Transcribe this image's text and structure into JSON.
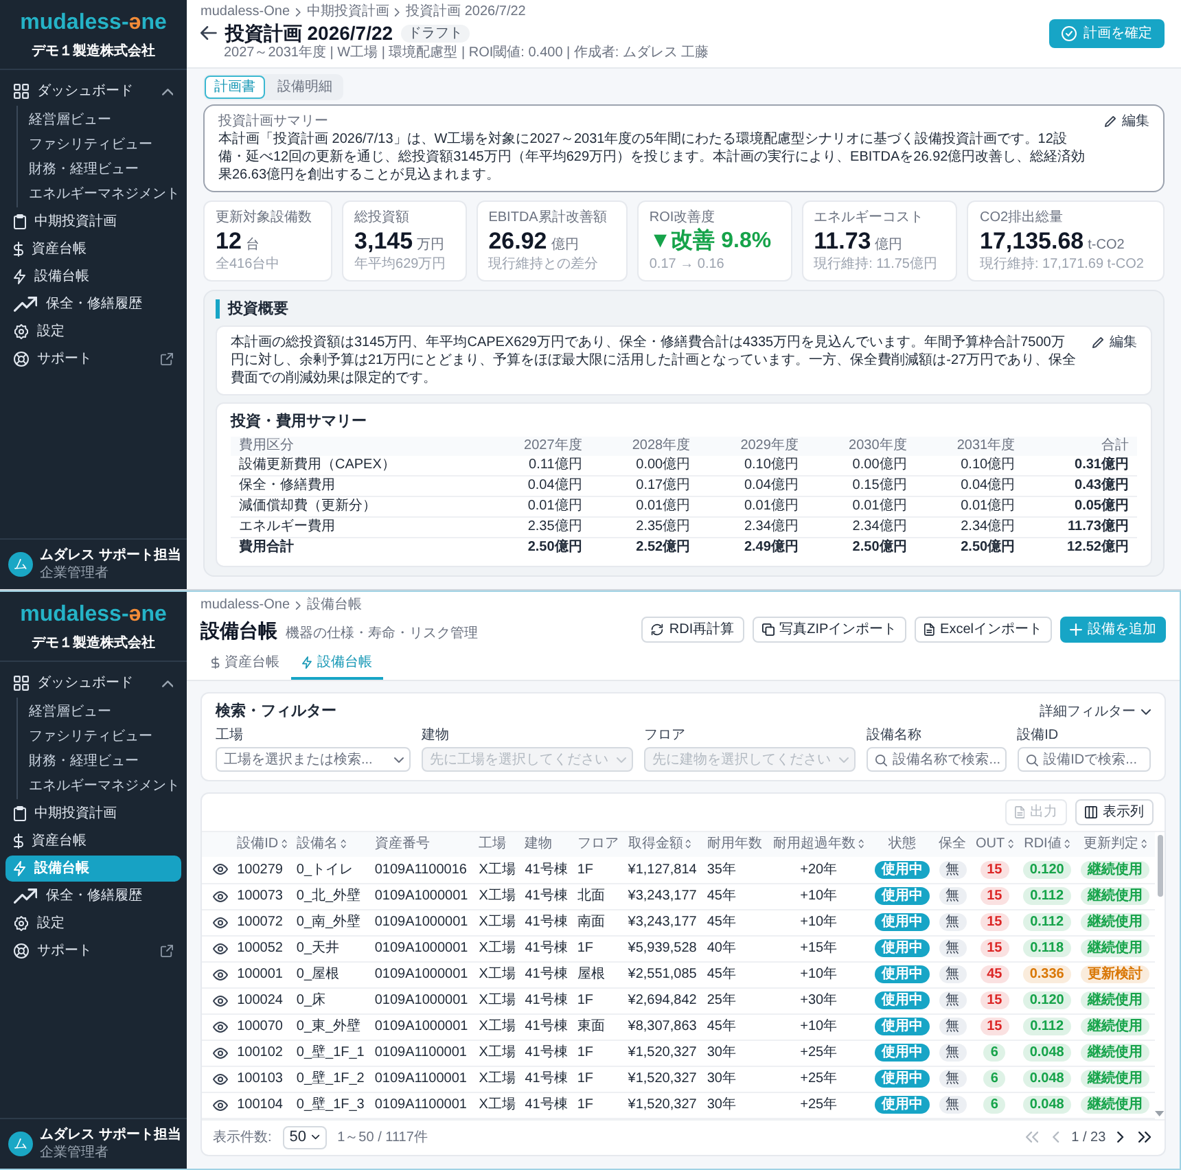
{
  "plan_screen": {
    "sidebar": {
      "logo": {
        "text": "mudaless-",
        "accent": "ə",
        "tail": "ne"
      },
      "company": "デモ１製造株式会社",
      "items": [
        {
          "label": "ダッシュボード",
          "selected": false,
          "expanded": true,
          "children": [
            {
              "label": "経営層ビュー",
              "selected": false
            },
            {
              "label": "ファシリティビュー",
              "selected": false
            },
            {
              "label": "財務・経理ビュー",
              "selected": false
            },
            {
              "label": "エネルギーマネジメント",
              "selected": false
            }
          ]
        },
        {
          "label": "中期投資計画",
          "selected": false
        },
        {
          "label": "資産台帳",
          "selected": false
        },
        {
          "label": "設備台帳",
          "selected": false
        },
        {
          "label": "保全・修繕履歴",
          "selected": false
        },
        {
          "label": "設定",
          "selected": false
        },
        {
          "label": "サポート",
          "selected": false,
          "external": true
        }
      ],
      "user": {
        "avatar": "ム",
        "name": "ムダレス サポート担当",
        "role": "企業管理者"
      }
    },
    "breadcrumb": [
      "mudaless-One",
      "中期投資計画",
      "投資計画 2026/7/22"
    ],
    "title": "投資計画 2026/7/22",
    "badge": "ドラフト",
    "subtitle": "2027～2031年度 | W工場 | 環境配慮型 | ROI閾値: 0.400 | 作成者: ムダレス 工藤",
    "confirm_button": "計画を確定",
    "tabs": [
      {
        "label": "計画書",
        "selected": true
      },
      {
        "label": "設備明細",
        "selected": false
      }
    ],
    "summary": {
      "label": "投資計画サマリー",
      "text": "本計画「投資計画 2026/7/13」は、W工場を対象に2027～2031年度の5年間にわたる環境配慮型シナリオに基づく設備投資計画です。12設備・延べ12回の更新を通じ、総投資額3145万円（年平均629万円）を投じます。本計画の実行により、EBITDAを26.92億円改善し、総経済効果26.63億円を創出することが見込まれます。",
      "edit_button": "編集"
    },
    "kpis": [
      {
        "kind": "metric",
        "label": "更新対象設備数",
        "value": "12",
        "unit": "台",
        "note": "全416台中"
      },
      {
        "kind": "metric",
        "label": "総投資額",
        "value": "3,145",
        "unit": "万円",
        "note": "年平均629万円"
      },
      {
        "kind": "metric",
        "label": "EBITDA累計改善額",
        "value": "26.92",
        "unit": "億円",
        "note": "現行維持との差分"
      },
      {
        "kind": "delta",
        "label": "ROI改善度",
        "value": "▼改善 9.8%",
        "note": "0.17 → 0.16"
      },
      {
        "kind": "metric",
        "label": "エネルギーコスト",
        "value": "11.73",
        "unit": "億円",
        "note": "現行維持: 11.75億円"
      },
      {
        "kind": "metric",
        "label": "CO2排出総量",
        "value": "17,135.68",
        "unit": "t-CO2",
        "note": "現行維持: 17,171.69 t-CO2"
      }
    ],
    "overview": {
      "title": "投資概要",
      "text": "本計画の総投資額は3145万円、年平均CAPEX629万円であり、保全・修繕費合計は4335万円を見込んでいます。年間予算枠合計7500万円に対し、余剰予算は21万円にとどまり、予算をほぼ最大限に活用した計画となっています。一方、保全費削減額は-27万円であり、保全費面での削減効果は限定的です。",
      "edit_button": "編集",
      "cost_table": {
        "title": "投資・費用サマリー",
        "columns": [
          "費用区分",
          "2027年度",
          "2028年度",
          "2029年度",
          "2030年度",
          "2031年度",
          "合計"
        ],
        "rows": [
          {
            "cells": [
              "設備更新費用（CAPEX）",
              "0.11億円",
              "0.00億円",
              "0.10億円",
              "0.00億円",
              "0.10億円",
              "0.31億円"
            ],
            "total": false
          },
          {
            "cells": [
              "保全・修繕費用",
              "0.04億円",
              "0.17億円",
              "0.04億円",
              "0.15億円",
              "0.04億円",
              "0.43億円"
            ],
            "total": false
          },
          {
            "cells": [
              "減価償却費（更新分）",
              "0.01億円",
              "0.01億円",
              "0.01億円",
              "0.01億円",
              "0.01億円",
              "0.05億円"
            ],
            "total": false
          },
          {
            "cells": [
              "エネルギー費用",
              "2.35億円",
              "2.35億円",
              "2.34億円",
              "2.34億円",
              "2.34億円",
              "11.73億円"
            ],
            "total": false
          },
          {
            "cells": [
              "費用合計",
              "2.50億円",
              "2.52億円",
              "2.49億円",
              "2.50億円",
              "2.50億円",
              "12.52億円"
            ],
            "total": true
          }
        ]
      }
    }
  },
  "ledger_screen": {
    "sidebar": {
      "logo": {
        "text": "mudaless-",
        "accent": "ə",
        "tail": "ne"
      },
      "company": "デモ１製造株式会社",
      "items": [
        {
          "label": "ダッシュボード",
          "selected": false,
          "expanded": true,
          "children": [
            {
              "label": "経営層ビュー",
              "selected": false
            },
            {
              "label": "ファシリティビュー",
              "selected": false
            },
            {
              "label": "財務・経理ビュー",
              "selected": false
            },
            {
              "label": "エネルギーマネジメント",
              "selected": false
            }
          ]
        },
        {
          "label": "中期投資計画",
          "selected": false
        },
        {
          "label": "資産台帳",
          "selected": false
        },
        {
          "label": "設備台帳",
          "selected": true
        },
        {
          "label": "保全・修繕履歴",
          "selected": false
        },
        {
          "label": "設定",
          "selected": false
        },
        {
          "label": "サポート",
          "selected": false,
          "external": true
        }
      ],
      "user": {
        "avatar": "ム",
        "name": "ムダレス サポート担当",
        "role": "企業管理者"
      }
    },
    "breadcrumb": [
      "mudaless-One",
      "設備台帳"
    ],
    "title": "設備台帳",
    "subtitle": "機器の仕様・寿命・リスク管理",
    "actions": [
      {
        "label": "RDI再計算",
        "primary": false
      },
      {
        "label": "写真ZIPインポート",
        "primary": false
      },
      {
        "label": "Excelインポート",
        "primary": false
      },
      {
        "label": "設備を追加",
        "primary": true
      }
    ],
    "tabs": [
      {
        "label": "資産台帳",
        "selected": false
      },
      {
        "label": "設備台帳",
        "selected": true
      }
    ],
    "filter": {
      "title": "検索・フィルター",
      "toggle": "詳細フィルター",
      "fields": [
        {
          "label": "工場",
          "kind": "select",
          "placeholder": "工場を選択または検索...",
          "disabled": false
        },
        {
          "label": "建物",
          "kind": "select",
          "placeholder": "先に工場を選択してください",
          "disabled": true
        },
        {
          "label": "フロア",
          "kind": "select",
          "placeholder": "先に建物を選択してください",
          "disabled": true
        },
        {
          "label": "設備名称",
          "kind": "search",
          "placeholder": "設備名称で検索...",
          "disabled": false
        },
        {
          "label": "設備ID",
          "kind": "search",
          "placeholder": "設備IDで検索...",
          "disabled": false
        }
      ]
    },
    "table": {
      "toolbar": [
        {
          "label": "出力",
          "disabled": true
        },
        {
          "label": "表示列",
          "disabled": false
        }
      ],
      "columns": [
        {
          "label": "設備ID",
          "sortable": true
        },
        {
          "label": "設備名",
          "sortable": true
        },
        {
          "label": "資産番号",
          "sortable": false
        },
        {
          "label": "工場",
          "sortable": false
        },
        {
          "label": "建物",
          "sortable": false
        },
        {
          "label": "フロア",
          "sortable": false
        },
        {
          "label": "取得金額",
          "sortable": true
        },
        {
          "label": "耐用年数",
          "sortable": false
        },
        {
          "label": "耐用超過年数",
          "sortable": true
        },
        {
          "label": "状態",
          "sortable": false
        },
        {
          "label": "保全",
          "sortable": false
        },
        {
          "label": "OUT",
          "sortable": true
        },
        {
          "label": "RDI値",
          "sortable": true
        },
        {
          "label": "更新判定",
          "sortable": true
        }
      ],
      "rows": [
        {
          "id": "100279",
          "name": "0_トイレ",
          "asset_no": "0109A1100016",
          "plant": "X工場",
          "building": "41号棟",
          "floor": "1F",
          "acquisition_cost": "¥1,127,814",
          "useful_life": "35年",
          "over_life": "+20年",
          "status": "使用中",
          "maintenance": "無",
          "out": {
            "value": "15",
            "color": "#dc2626"
          },
          "rdi": {
            "value": "0.120",
            "color": "#16a34a"
          },
          "decision": {
            "value": "継続使用",
            "color": "#16a34a"
          }
        },
        {
          "id": "100073",
          "name": "0_北_外壁",
          "asset_no": "0109A1000001",
          "plant": "X工場",
          "building": "41号棟",
          "floor": "北面",
          "acquisition_cost": "¥3,243,177",
          "useful_life": "45年",
          "over_life": "+10年",
          "status": "使用中",
          "maintenance": "無",
          "out": {
            "value": "15",
            "color": "#dc2626"
          },
          "rdi": {
            "value": "0.112",
            "color": "#16a34a"
          },
          "decision": {
            "value": "継続使用",
            "color": "#16a34a"
          }
        },
        {
          "id": "100072",
          "name": "0_南_外壁",
          "asset_no": "0109A1000001",
          "plant": "X工場",
          "building": "41号棟",
          "floor": "南面",
          "acquisition_cost": "¥3,243,177",
          "useful_life": "45年",
          "over_life": "+10年",
          "status": "使用中",
          "maintenance": "無",
          "out": {
            "value": "15",
            "color": "#dc2626"
          },
          "rdi": {
            "value": "0.112",
            "color": "#16a34a"
          },
          "decision": {
            "value": "継続使用",
            "color": "#16a34a"
          }
        },
        {
          "id": "100052",
          "name": "0_天井",
          "asset_no": "0109A1000001",
          "plant": "X工場",
          "building": "41号棟",
          "floor": "1F",
          "acquisition_cost": "¥5,939,528",
          "useful_life": "40年",
          "over_life": "+15年",
          "status": "使用中",
          "maintenance": "無",
          "out": {
            "value": "15",
            "color": "#dc2626"
          },
          "rdi": {
            "value": "0.118",
            "color": "#16a34a"
          },
          "decision": {
            "value": "継続使用",
            "color": "#16a34a"
          }
        },
        {
          "id": "100001",
          "name": "0_屋根",
          "asset_no": "0109A1000001",
          "plant": "X工場",
          "building": "41号棟",
          "floor": "屋根",
          "acquisition_cost": "¥2,551,085",
          "useful_life": "45年",
          "over_life": "+10年",
          "status": "使用中",
          "maintenance": "無",
          "out": {
            "value": "45",
            "color": "#dc2626"
          },
          "rdi": {
            "value": "0.336",
            "color": "#d97706"
          },
          "decision": {
            "value": "更新検討",
            "color": "#d97706"
          }
        },
        {
          "id": "100024",
          "name": "0_床",
          "asset_no": "0109A1000001",
          "plant": "X工場",
          "building": "41号棟",
          "floor": "1F",
          "acquisition_cost": "¥2,694,842",
          "useful_life": "25年",
          "over_life": "+30年",
          "status": "使用中",
          "maintenance": "無",
          "out": {
            "value": "15",
            "color": "#dc2626"
          },
          "rdi": {
            "value": "0.120",
            "color": "#16a34a"
          },
          "decision": {
            "value": "継続使用",
            "color": "#16a34a"
          }
        },
        {
          "id": "100070",
          "name": "0_東_外壁",
          "asset_no": "0109A1000001",
          "plant": "X工場",
          "building": "41号棟",
          "floor": "東面",
          "acquisition_cost": "¥8,307,863",
          "useful_life": "45年",
          "over_life": "+10年",
          "status": "使用中",
          "maintenance": "無",
          "out": {
            "value": "15",
            "color": "#dc2626"
          },
          "rdi": {
            "value": "0.112",
            "color": "#16a34a"
          },
          "decision": {
            "value": "継続使用",
            "color": "#16a34a"
          }
        },
        {
          "id": "100102",
          "name": "0_壁_1F_1",
          "asset_no": "0109A1100001",
          "plant": "X工場",
          "building": "41号棟",
          "floor": "1F",
          "acquisition_cost": "¥1,520,327",
          "useful_life": "30年",
          "over_life": "+25年",
          "status": "使用中",
          "maintenance": "無",
          "out": {
            "value": "6",
            "color": "#16a34a"
          },
          "rdi": {
            "value": "0.048",
            "color": "#16a34a"
          },
          "decision": {
            "value": "継続使用",
            "color": "#16a34a"
          }
        },
        {
          "id": "100103",
          "name": "0_壁_1F_2",
          "asset_no": "0109A1100001",
          "plant": "X工場",
          "building": "41号棟",
          "floor": "1F",
          "acquisition_cost": "¥1,520,327",
          "useful_life": "30年",
          "over_life": "+25年",
          "status": "使用中",
          "maintenance": "無",
          "out": {
            "value": "6",
            "color": "#16a34a"
          },
          "rdi": {
            "value": "0.048",
            "color": "#16a34a"
          },
          "decision": {
            "value": "継続使用",
            "color": "#16a34a"
          }
        },
        {
          "id": "100104",
          "name": "0_壁_1F_3",
          "asset_no": "0109A1100001",
          "plant": "X工場",
          "building": "41号棟",
          "floor": "1F",
          "acquisition_cost": "¥1,520,327",
          "useful_life": "30年",
          "over_life": "+25年",
          "status": "使用中",
          "maintenance": "無",
          "out": {
            "value": "6",
            "color": "#16a34a"
          },
          "rdi": {
            "value": "0.048",
            "color": "#16a34a"
          },
          "decision": {
            "value": "継続使用",
            "color": "#16a34a"
          }
        }
      ],
      "footer": {
        "page_size_label": "表示件数:",
        "page_size": "50",
        "range": "1～50 / 1117件",
        "pager": [
          {
            "kind": "first",
            "disabled": true
          },
          {
            "kind": "prev",
            "disabled": true
          },
          {
            "kind": "next",
            "disabled": false
          },
          {
            "kind": "last",
            "disabled": false
          }
        ],
        "page": "1 / 23"
      }
    }
  }
}
